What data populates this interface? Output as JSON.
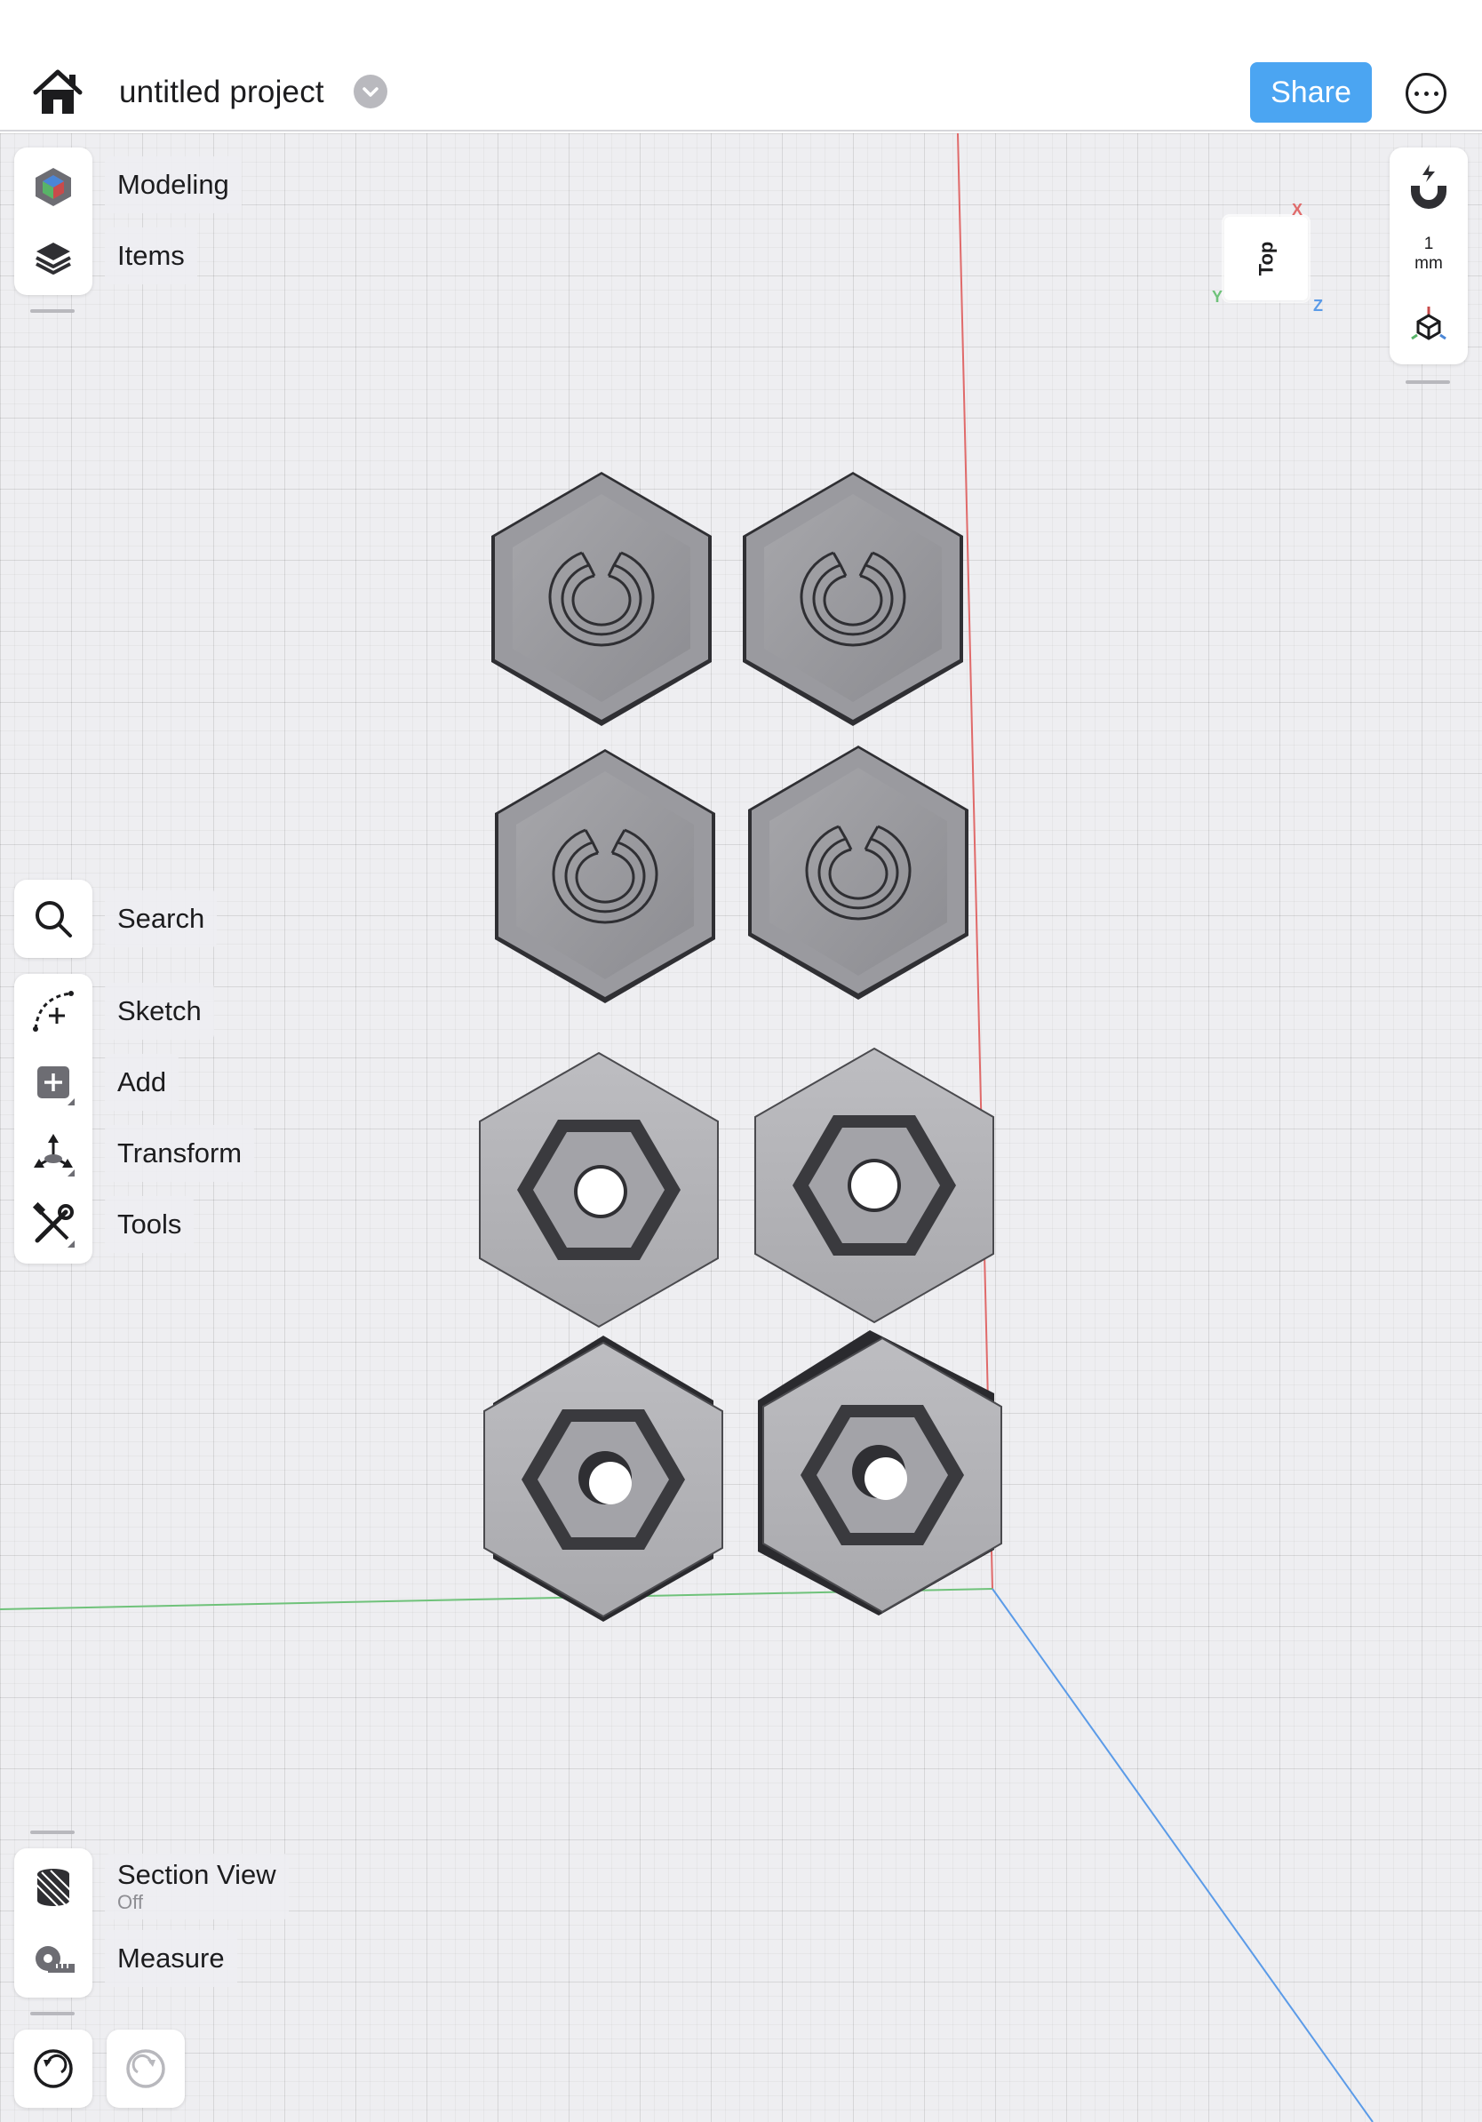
{
  "header": {
    "project_title": "untitled project",
    "share_label": "Share"
  },
  "workspace": {
    "modeling_label": "Modeling",
    "items_label": "Items"
  },
  "tools": {
    "search_label": "Search",
    "sketch_label": "Sketch",
    "add_label": "Add",
    "transform_label": "Transform",
    "tools_label": "Tools"
  },
  "bottom_tools": {
    "section_view_label": "Section View",
    "section_view_state": "Off",
    "measure_label": "Measure"
  },
  "right_toolbar": {
    "grid_value": "1",
    "grid_unit": "mm"
  },
  "view_cube": {
    "face_label": "Top",
    "axis_x": "X",
    "axis_y": "Y",
    "axis_z": "Z"
  },
  "colors": {
    "accent": "#4ba5f2",
    "axis_red": "#e06a6a",
    "axis_green": "#6fc27a",
    "axis_blue": "#5b9be8"
  },
  "icons": [
    "home-icon",
    "chevron-down-icon",
    "more-icon",
    "modeling-cube-icon",
    "layers-icon",
    "search-icon",
    "sketch-icon",
    "add-icon",
    "transform-icon",
    "tools-icon",
    "section-view-icon",
    "measure-tape-icon",
    "undo-icon",
    "redo-icon",
    "snap-magnet-icon",
    "view-orientation-icon"
  ]
}
